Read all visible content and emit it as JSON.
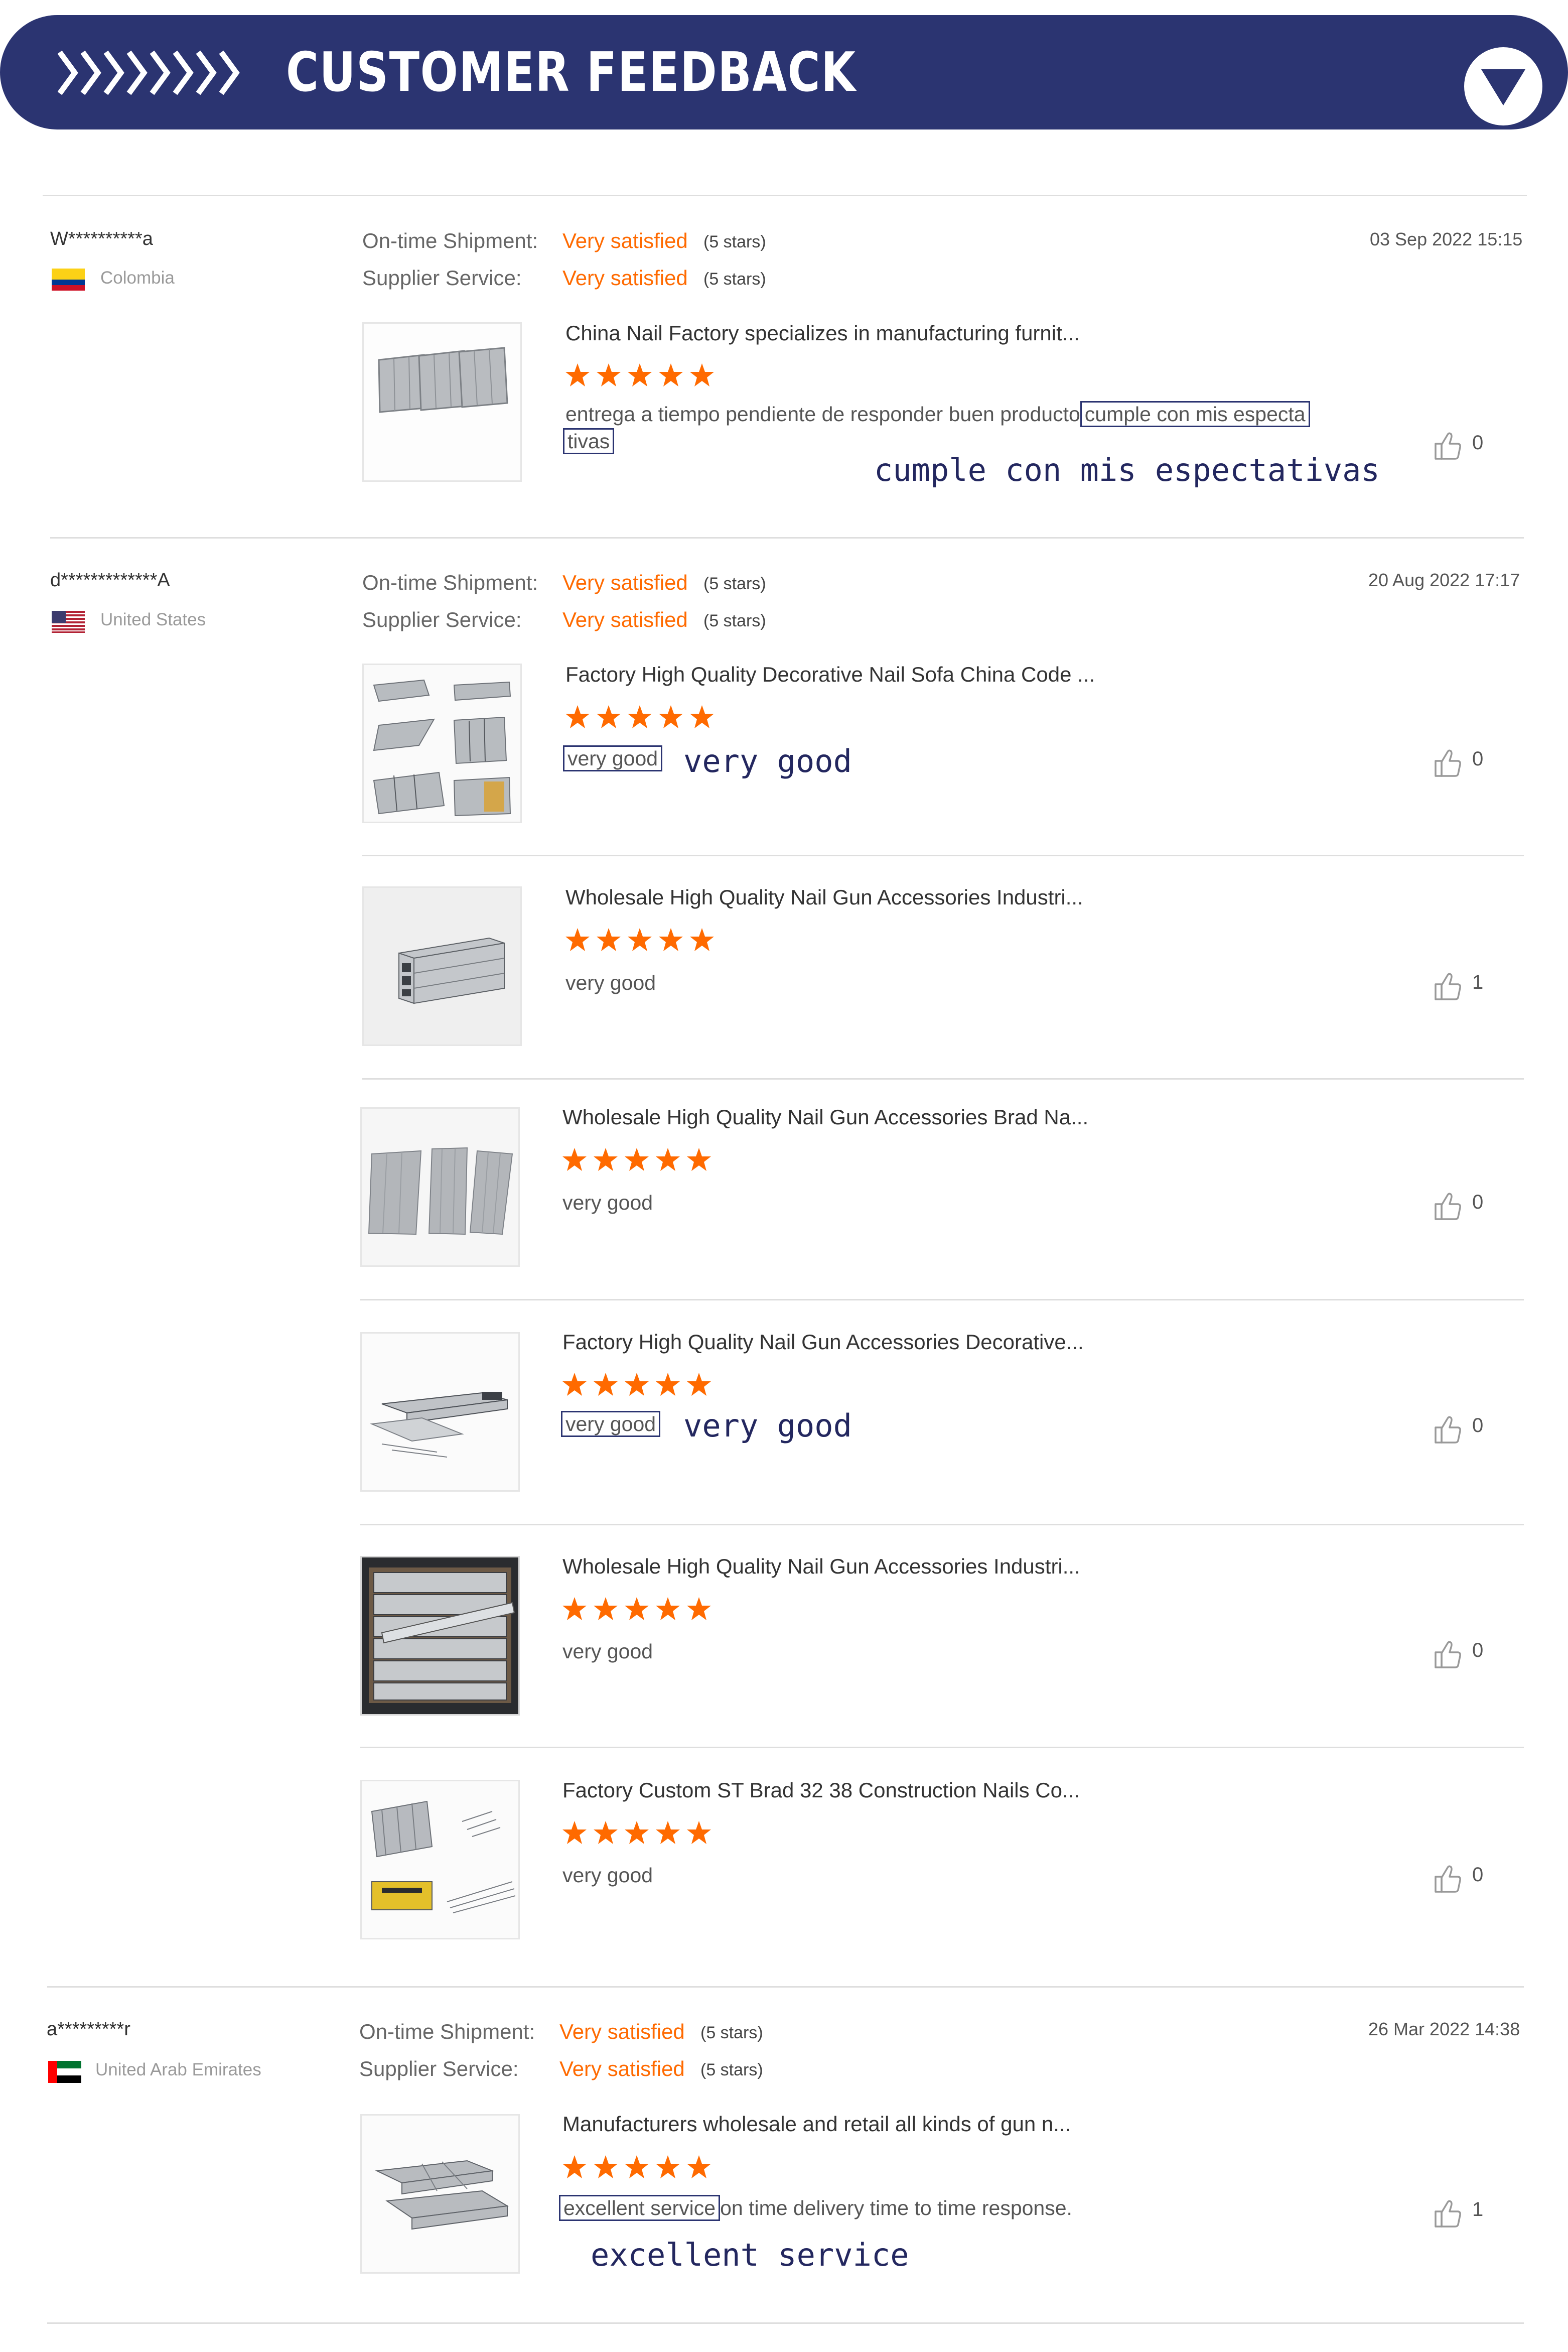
{
  "header": {
    "title": "CUSTOMER FEEDBACK",
    "chevron_count": 8,
    "toggle_icon": "triangle-down-icon",
    "colors": {
      "banner": "#2b3471",
      "text": "#ffffff"
    }
  },
  "labels": {
    "shipment": "On-time Shipment:",
    "service": "Supplier Service:"
  },
  "colors": {
    "accent": "#ff6a00",
    "callout": "#23275f"
  },
  "reviews": [
    {
      "user": "W**********a",
      "country": "Colombia",
      "date": "03 Sep 2022 15:15",
      "shipment": {
        "rating": "Very satisfied",
        "stars": "(5 stars)"
      },
      "service": {
        "rating": "Very satisfied",
        "stars": "(5 stars)"
      },
      "items": [
        {
          "title": "China Nail Factory specializes in manufacturing furnit...",
          "stars": 5,
          "text_before": "entrega a tiempo pendiente de responder buen producto",
          "highlight_line1": "cumple con mis especta",
          "highlight_line2": "tivas",
          "callout": "cumple con mis espectativas",
          "likes": "0"
        }
      ]
    },
    {
      "user": "d*************A",
      "country": "United States",
      "date": "20 Aug 2022 17:17",
      "shipment": {
        "rating": "Very satisfied",
        "stars": "(5 stars)"
      },
      "service": {
        "rating": "Very satisfied",
        "stars": "(5 stars)"
      },
      "items": [
        {
          "title": "Factory High Quality Decorative Nail Sofa China Code ...",
          "stars": 5,
          "text": "very good",
          "callout": "very good",
          "likes": "0"
        },
        {
          "title": "Wholesale High Quality Nail Gun Accessories Industri...",
          "stars": 5,
          "text": "very good",
          "likes": "1"
        },
        {
          "title": "Wholesale High Quality Nail Gun Accessories Brad Na...",
          "stars": 5,
          "text": "very good",
          "likes": "0"
        },
        {
          "title": "Factory High Quality Nail Gun Accessories Decorative...",
          "stars": 5,
          "text": "very good",
          "callout": "very good",
          "likes": "0"
        },
        {
          "title": "Wholesale High Quality Nail Gun Accessories Industri...",
          "stars": 5,
          "text": "very good",
          "likes": "0"
        },
        {
          "title": "Factory Custom ST Brad 32 38 Construction Nails Co...",
          "stars": 5,
          "text": "very good",
          "likes": "0"
        }
      ]
    },
    {
      "user": "a*********r",
      "country": "United Arab Emirates",
      "date": "26 Mar 2022 14:38",
      "shipment": {
        "rating": "Very satisfied",
        "stars": "(5 stars)"
      },
      "service": {
        "rating": "Very satisfied",
        "stars": "(5 stars)"
      },
      "items": [
        {
          "title": "Manufacturers wholesale and retail all kinds of gun n...",
          "stars": 5,
          "highlight": "excellent service",
          "text_after": "on time delivery time to time response.",
          "callout": "excellent service",
          "likes": "1"
        }
      ]
    }
  ]
}
